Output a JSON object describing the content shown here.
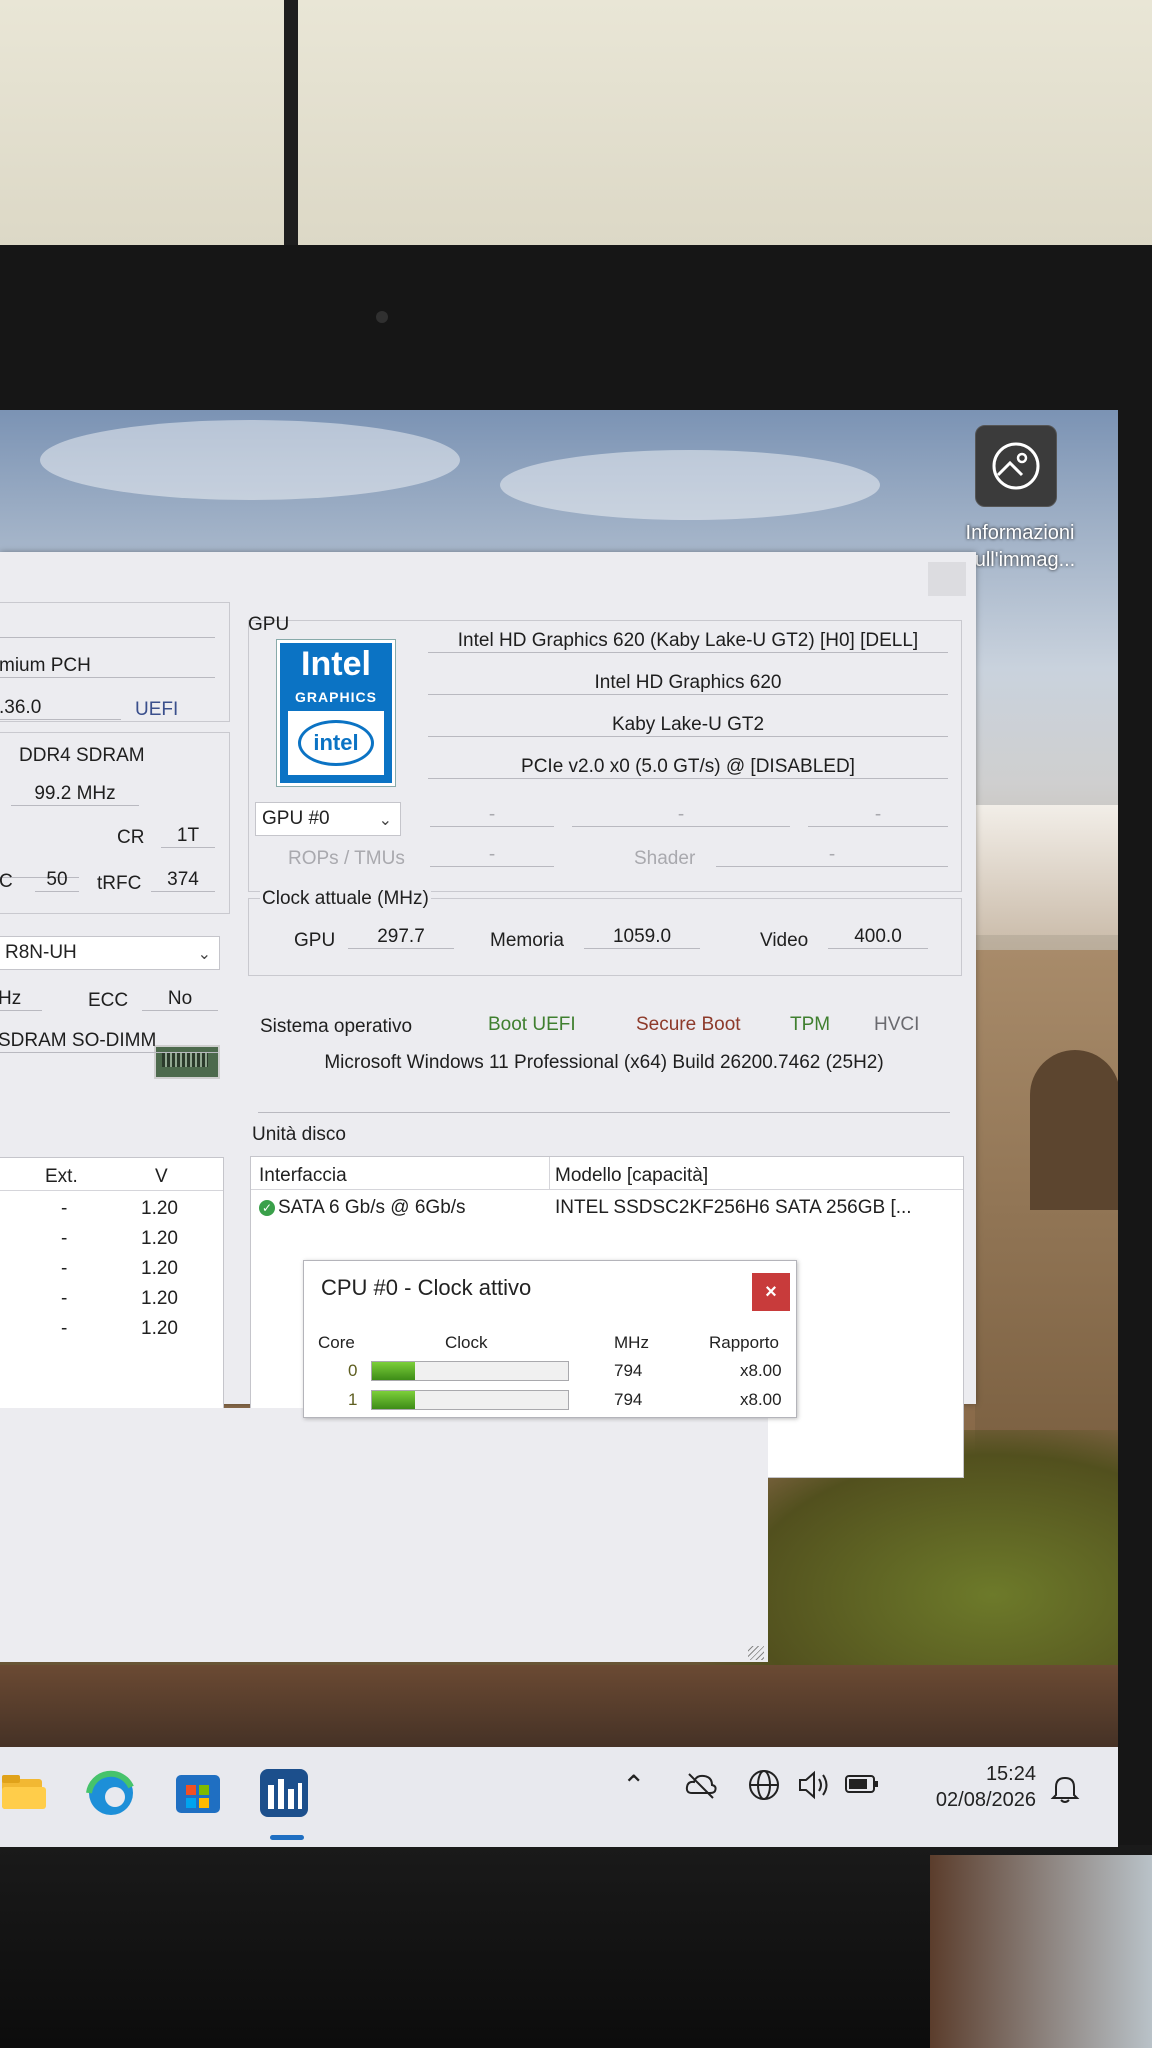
{
  "desktop": {
    "icon_name": "image-info-icon",
    "icon_label_line1": "Informazioni",
    "icon_label_line2": "sull'immag..."
  },
  "left_panel": {
    "chipset": "mium PCH",
    "bios_version": ".36.0",
    "bios_type": "UEFI",
    "mem_type": "DDR4 SDRAM",
    "mem_freq": "99.2 MHz",
    "cr_label": "CR",
    "cr_value": "1T",
    "c_label": "C",
    "c_value": "50",
    "trfc_label": "tRFC",
    "trfc_value": "374",
    "module_select": "R8N-UH",
    "hz_label": "Hz",
    "ecc_label": "ECC",
    "ecc_value": "No",
    "module_type": "SDRAM SO-DIMM",
    "table_headers": [
      "Ext.",
      "V"
    ],
    "table_rows": [
      {
        "ext": "-",
        "v": "1.20"
      },
      {
        "ext": "-",
        "v": "1.20"
      },
      {
        "ext": "-",
        "v": "1.20"
      },
      {
        "ext": "-",
        "v": "1.20"
      },
      {
        "ext": "-",
        "v": "1.20"
      }
    ]
  },
  "gpu": {
    "group_label": "GPU",
    "logo_brand": "Intel",
    "logo_sub": "GRAPHICS",
    "logo_oval": "intel",
    "name_full": "Intel HD Graphics 620 (Kaby Lake-U GT2) [H0] [DELL]",
    "name": "Intel HD Graphics 620",
    "codename": "Kaby Lake-U GT2",
    "bus": "PCIe v2.0 x0 (5.0 GT/s) @ [DISABLED]",
    "selector": "GPU #0",
    "dash": "-",
    "rops_label": "ROPs / TMUs",
    "shader_label": "Shader",
    "clock_group": "Clock attuale (MHz)",
    "gpu_label": "GPU",
    "gpu_value": "297.7",
    "mem_label": "Memoria",
    "mem_value": "1059.0",
    "video_label": "Video",
    "video_value": "400.0"
  },
  "os": {
    "label": "Sistema operativo",
    "boot_uefi": "Boot UEFI",
    "secure_boot": "Secure Boot",
    "tpm": "TPM",
    "hvci": "HVCI",
    "version": "Microsoft Windows 11 Professional (x64) Build 26200.7462 (25H2)"
  },
  "disks": {
    "label": "Unità disco",
    "col_interface": "Interfaccia",
    "col_model": "Modello [capacità]",
    "interface": "SATA 6 Gb/s @ 6Gb/s",
    "model": "INTEL SSDSC2KF256H6 SATA 256GB [..."
  },
  "popup": {
    "title": "CPU #0 - Clock attivo",
    "close": "×",
    "headers": {
      "core": "Core",
      "clock": "Clock",
      "mhz": "MHz",
      "ratio": "Rapporto"
    },
    "rows": [
      {
        "core": "0",
        "mhz": "794",
        "ratio": "x8.00",
        "load": 0.22
      },
      {
        "core": "1",
        "mhz": "794",
        "ratio": "x8.00",
        "load": 0.22
      }
    ]
  },
  "taskbar": {
    "apps": [
      "file-explorer-icon",
      "edge-icon",
      "store-icon",
      "hwinfo-icon"
    ],
    "tray": [
      "chevron-up-icon",
      "cloud-off-icon",
      "network-icon",
      "volume-icon",
      "battery-icon",
      "notification-bell-icon"
    ],
    "time": "15:24",
    "date": "02/08/2026"
  },
  "colors": {
    "accent_green": "#3f7f2f",
    "secure_boot": "#8d3a2a",
    "close_red": "#c83b3b",
    "intel_blue": "#0b73c4"
  }
}
